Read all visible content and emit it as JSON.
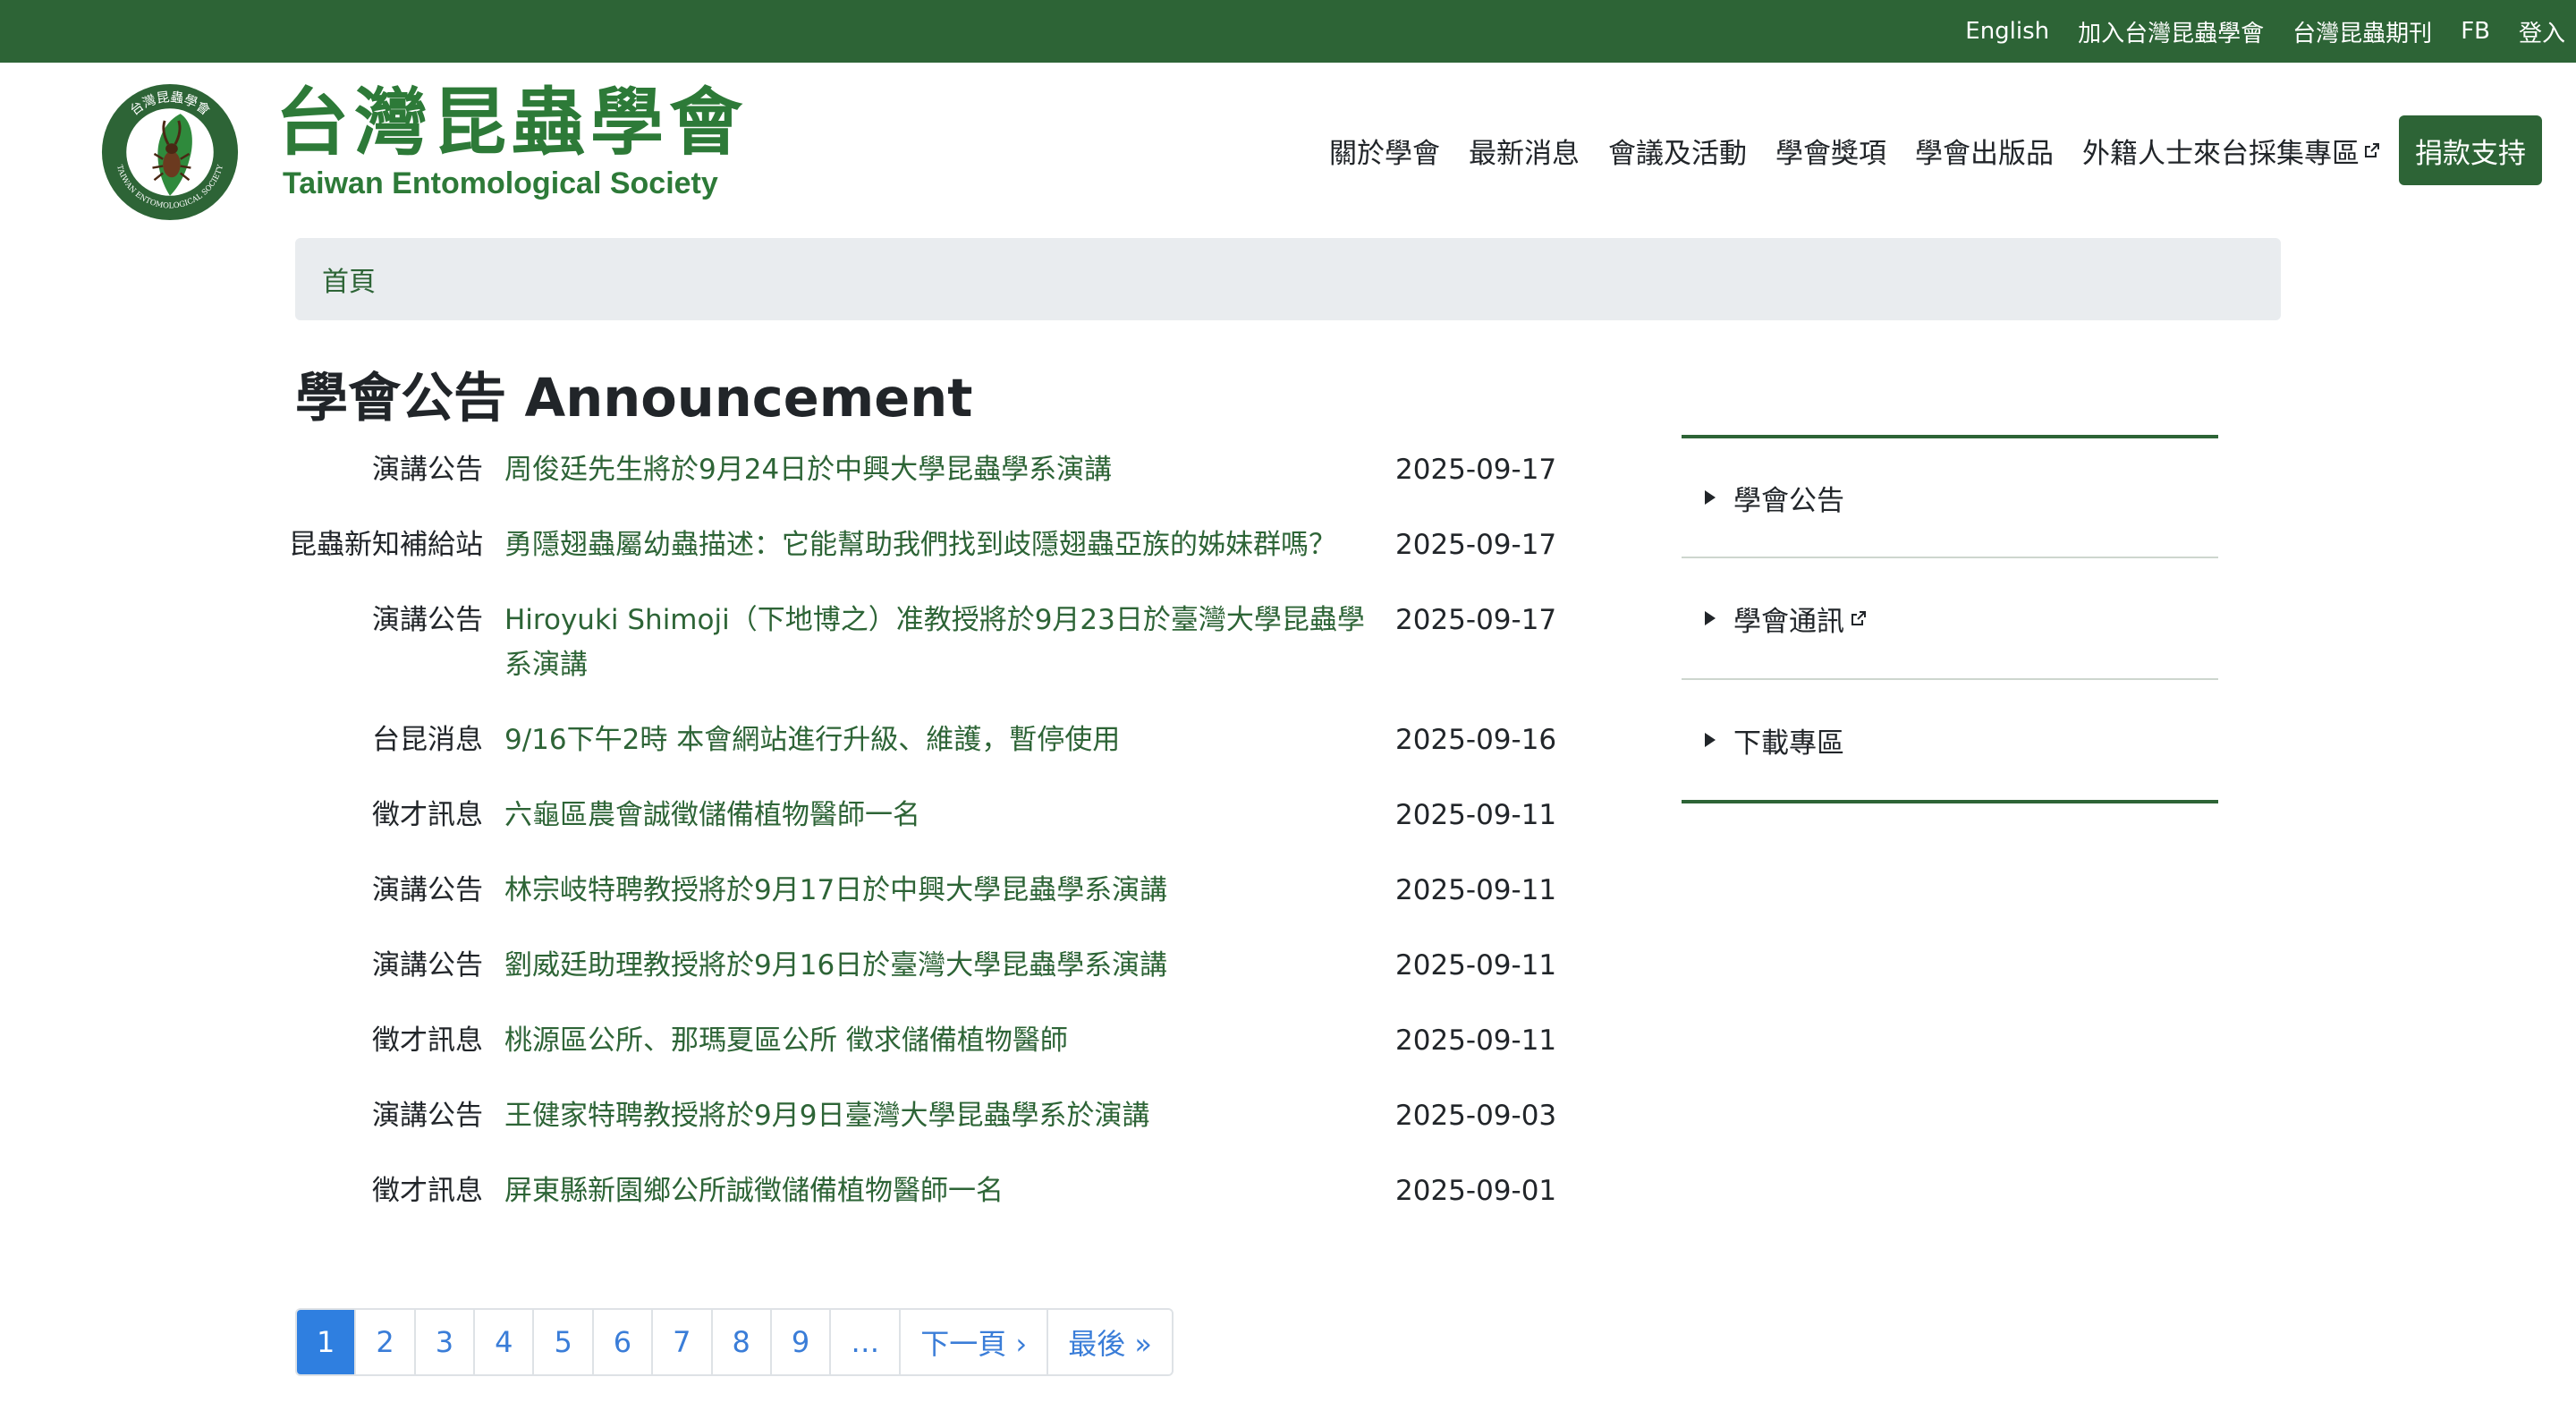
{
  "topbar": {
    "links": [
      "English",
      "加入台灣昆蟲學會",
      "台灣昆蟲期刊",
      "FB",
      "登入"
    ]
  },
  "brand": {
    "name_zh": "台灣昆蟲學會",
    "name_en": "Taiwan Entomological Society",
    "logo_ring_top": "台灣昆蟲學會",
    "logo_ring_bottom": "TAIWAN ENTOMOLOGICAL SOCIETY"
  },
  "nav": {
    "items": [
      "關於學會",
      "最新消息",
      "會議及活動",
      "學會獎項",
      "學會出版品",
      "外籍人士來台採集專區"
    ],
    "donate": "捐款支持"
  },
  "breadcrumb": {
    "home": "首頁"
  },
  "page": {
    "title": "學會公告 Announcement"
  },
  "announcements": [
    {
      "category": "演講公告",
      "title": "周俊廷先生將於9月24日於中興大學昆蟲學系演講",
      "date": "2025-09-17"
    },
    {
      "category": "昆蟲新知補給站",
      "title": "勇隱翅蟲屬幼蟲描述：它能幫助我們找到歧隱翅蟲亞族的姊妹群嗎？",
      "date": "2025-09-17"
    },
    {
      "category": "演講公告",
      "title": "Hiroyuki Shimoji（下地博之）准教授將於9月23日於臺灣大學昆蟲學系演講",
      "date": "2025-09-17"
    },
    {
      "category": "台昆消息",
      "title": "9/16下午2時 本會網站進行升級、維護，暫停使用",
      "date": "2025-09-16"
    },
    {
      "category": "徵才訊息",
      "title": "六龜區農會誠徵儲備植物醫師一名",
      "date": "2025-09-11"
    },
    {
      "category": "演講公告",
      "title": "林宗岐特聘教授將於9月17日於中興大學昆蟲學系演講",
      "date": "2025-09-11"
    },
    {
      "category": "演講公告",
      "title": "劉威廷助理教授將於9月16日於臺灣大學昆蟲學系演講",
      "date": "2025-09-11"
    },
    {
      "category": "徵才訊息",
      "title": "桃源區公所、那瑪夏區公所 徵求儲備植物醫師",
      "date": "2025-09-11"
    },
    {
      "category": "演講公告",
      "title": "王健家特聘教授將於9月9日臺灣大學昆蟲學系於演講",
      "date": "2025-09-03"
    },
    {
      "category": "徵才訊息",
      "title": "屏東縣新園鄉公所誠徵儲備植物醫師一名",
      "date": "2025-09-01"
    }
  ],
  "pagination": {
    "pages": [
      "1",
      "2",
      "3",
      "4",
      "5",
      "6",
      "7",
      "8",
      "9",
      "…"
    ],
    "current": "1",
    "next": "下一頁 ›",
    "last": "最後 »"
  },
  "sidebar": {
    "items": [
      "學會公告",
      "學會通訊",
      "下載專區"
    ]
  },
  "colors": {
    "brand_green": "#2d6436",
    "logo_green": "#2d7a38",
    "link_blue": "#3a7dd8",
    "active_blue": "#2f7fe0"
  },
  "icons": {
    "external_link": "external-link-icon",
    "disclosure": "disclosure-triangle-icon"
  }
}
